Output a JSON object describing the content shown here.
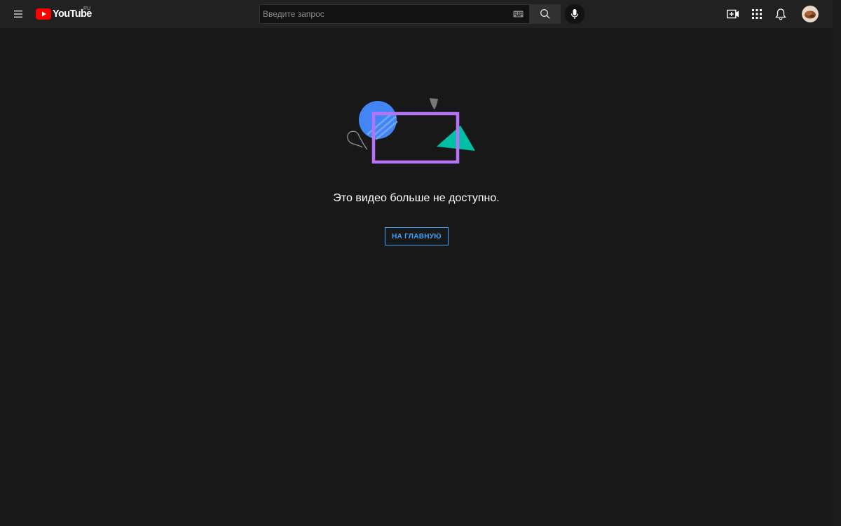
{
  "header": {
    "logo_text": "YouTube",
    "country_code": "RU",
    "search": {
      "placeholder": "Введите запрос",
      "value": ""
    },
    "icons": [
      "menu-icon",
      "keyboard-icon",
      "search-icon",
      "mic-icon",
      "create-video-icon",
      "apps-grid-icon",
      "bell-icon",
      "avatar"
    ]
  },
  "error": {
    "message": "Это видео больше не доступно.",
    "home_button_label": "НА ГЛАВНУЮ"
  },
  "colors": {
    "background": "#181818",
    "topbar": "#212121",
    "accent_blue": "#3ea6ff",
    "youtube_red": "#ff0000",
    "illustration_purple": "#b673f8",
    "illustration_blue": "#4285f4",
    "illustration_teal": "#00bfa5"
  }
}
